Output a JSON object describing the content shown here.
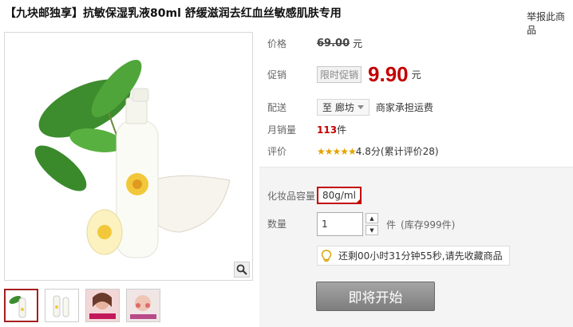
{
  "title": "【九块邮独享】抗敏保湿乳液80ml 舒缓滋润去红血丝敏感肌肤专用",
  "report_link": "举报此商品",
  "price": {
    "label": "价格",
    "original": "69.00",
    "currency": "元"
  },
  "promo": {
    "label": "促销",
    "tag": "限时促销",
    "price": "9.90",
    "currency": "元"
  },
  "shipping": {
    "label": "配送",
    "destination": "至 廊坊",
    "note": "商家承担运费"
  },
  "monthly_sales": {
    "label": "月销量",
    "count": "113",
    "unit": "件"
  },
  "rating": {
    "label": "评价",
    "stars": "★★★★★",
    "score": "4.8分",
    "count_text": "(累计评价28)"
  },
  "capacity": {
    "label": "化妆品容量",
    "selected": "80g/ml"
  },
  "quantity": {
    "label": "数量",
    "value": "1",
    "unit": "件",
    "stock": "(库存999件)"
  },
  "notice": {
    "text": "还剩00小时31分钟55秒,请先收藏商品"
  },
  "buy_button": "即将开始",
  "colors": {
    "accent": "#c40000",
    "button": "#8f8f8f",
    "star": "#e3a300"
  },
  "icons": [
    "zoom-icon",
    "lightbulb-icon",
    "chevron-down-icon",
    "spin-up-icon",
    "spin-down-icon"
  ]
}
